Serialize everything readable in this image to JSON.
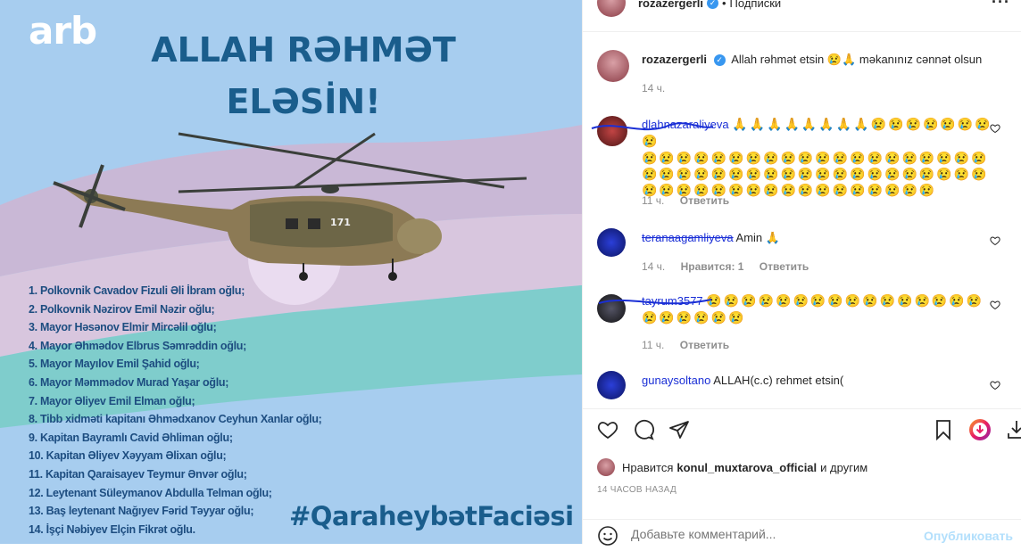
{
  "post_image": {
    "logo": "arb",
    "title_line1": "ALLAH RƏHMƏT",
    "title_line2": "ELƏSİN!",
    "names": [
      "1. Polkovnik Cavadov Fizuli Əli İbram oğlu;",
      "2. Polkovnik Nəzirov Emil Nəzir oğlu;",
      "3. Mayor Həsənov Elmir Mircəlil oğlu;",
      "4. Mayor Əhmədov Elbrus Səmrəddin oğlu;",
      "5. Mayor Mayılov Emil Şahid oğlu;",
      "6. Mayor Məmmədov Murad Yaşar oğlu;",
      "7. Mayor Əliyev Emil Elman oğlu;",
      "8. Tibb xidməti kapitanı Əhmədxanov Ceyhun Xanlar oğlu;",
      "9. Kapitan Bayramlı Cavid Əhliman oğlu;",
      "10. Kapitan Əliyev Xəyyam Əlixan oğlu;",
      "11. Kapitan Qaraisayev Teymur Ənvər oğlu;",
      "12. Leytenant Süleymanov Abdulla Telman oğlu;",
      "13. Baş leytenant Nağıyev Fərid Təyyar oğlu;",
      "14. İşçi Nəbiyev Elçin Fikrət oğlu."
    ],
    "hashtag": "#QaraheybətFaciəsi",
    "heli_number": "171"
  },
  "header": {
    "username": "rozazergerli",
    "separator": "•",
    "follow": "Подписки",
    "more_icon": "more-icon"
  },
  "caption": {
    "username": "rozazergerli",
    "text": "Allah rəhmət etsin 😢🙏 məkanınız cənnət olsun",
    "time": "14 ч."
  },
  "comments": [
    {
      "user": "dlahnazaraliyeva",
      "text_line1": "🙏🙏🙏🙏🙏🙏🙏🙏😢😢😢😢😢😢😢😢",
      "text_line2": "😢😢😢😢😢😢😢😢😢😢😢😢😢😢😢😢😢😢😢😢",
      "text_line3": "😢😢😢😢😢😢😢😢😢😢😢😢😢😢😢😢😢😢😢😢",
      "text_line4": "😢😢😢😢😢😢😢😢😢😢😢😢😢😢😢😢😢",
      "time": "11 ч.",
      "reply": "Ответить",
      "likes": ""
    },
    {
      "user": "teranaagamliyeva",
      "text_line1": "Amin 🙏",
      "time": "14 ч.",
      "likes": "Нравится: 1",
      "reply": "Ответить"
    },
    {
      "user": "tayrum3577",
      "text_line1": "😢😢😢😢😢😢😢😢😢😢😢😢😢😢😢😢",
      "text_line2": "😢😢😢😢😢😢",
      "time": "11 ч.",
      "reply": "Ответить",
      "likes": ""
    },
    {
      "user": "gunaysoltano",
      "text_line1": "ALLAH(c.c) rehmet etsin(",
      "time": "",
      "reply": "",
      "likes": ""
    }
  ],
  "likes": {
    "prefix": "Нравится",
    "user": "konul_muxtarova_official",
    "suffix": "и другим"
  },
  "post_time": "14 ЧАСОВ НАЗАД",
  "comment_input": {
    "placeholder": "Добавьте комментарий...",
    "publish": "Опубликовать"
  },
  "colors": {
    "accent": "#3897f0",
    "publish": "#b2dffc",
    "scribble": "#1a2fd6"
  }
}
